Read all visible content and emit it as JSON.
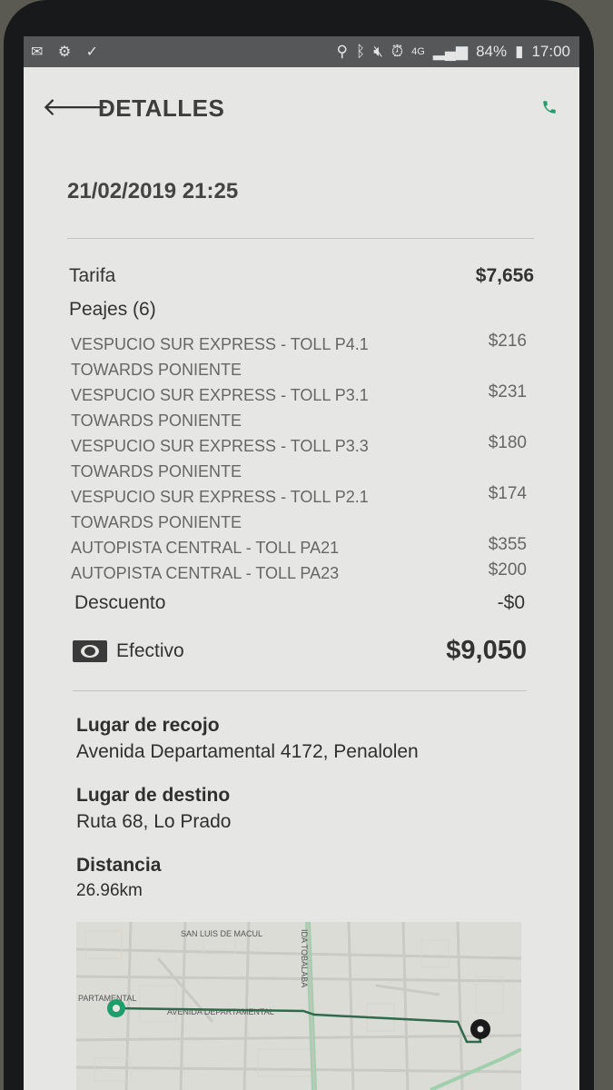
{
  "status_bar": {
    "battery": "84%",
    "time": "17:00",
    "network": "4G"
  },
  "header": {
    "title": "DETALLES"
  },
  "trip": {
    "datetime": "21/02/2019 21:25",
    "fare_label": "Tarifa",
    "fare_value": "$7,656",
    "tolls_label": "Peajes (6)",
    "tolls": [
      {
        "line1": "VESPUCIO SUR EXPRESS - TOLL P4.1",
        "line2": "TOWARDS PONIENTE",
        "amount": "$216"
      },
      {
        "line1": "VESPUCIO SUR EXPRESS - TOLL P3.1",
        "line2": "TOWARDS PONIENTE",
        "amount": "$231"
      },
      {
        "line1": "VESPUCIO SUR EXPRESS - TOLL P3.3",
        "line2": "TOWARDS PONIENTE",
        "amount": "$180"
      },
      {
        "line1": "VESPUCIO SUR EXPRESS - TOLL P2.1",
        "line2": "TOWARDS PONIENTE",
        "amount": "$174"
      },
      {
        "line1": "AUTOPISTA CENTRAL - TOLL PA21",
        "line2": "",
        "amount": "$355"
      },
      {
        "line1": "AUTOPISTA CENTRAL - TOLL PA23",
        "line2": "",
        "amount": "$200"
      }
    ],
    "discount_label": "Descuento",
    "discount_value": "-$0",
    "payment_method": "Efectivo",
    "total": "$9,050",
    "pickup_label": "Lugar de recojo",
    "pickup_value": "Avenida Departamental 4172, Penalolen",
    "destination_label": "Lugar de destino",
    "destination_value": "Ruta 68, Lo Prado",
    "distance_label": "Distancia",
    "distance_value": "26.96km"
  },
  "map": {
    "street_1": "SAN LUIS DE MACUL",
    "street_2": "IDA TOBALABA",
    "street_3": "AVENIDA DEPARTAMENTAL",
    "street_4": "PARTAMENTAL",
    "start_color": "#1f9d6b",
    "route_color": "#2f6a4a"
  },
  "colors": {
    "accent": "#1f9d6b",
    "screen_bg": "#e6e7e4"
  }
}
